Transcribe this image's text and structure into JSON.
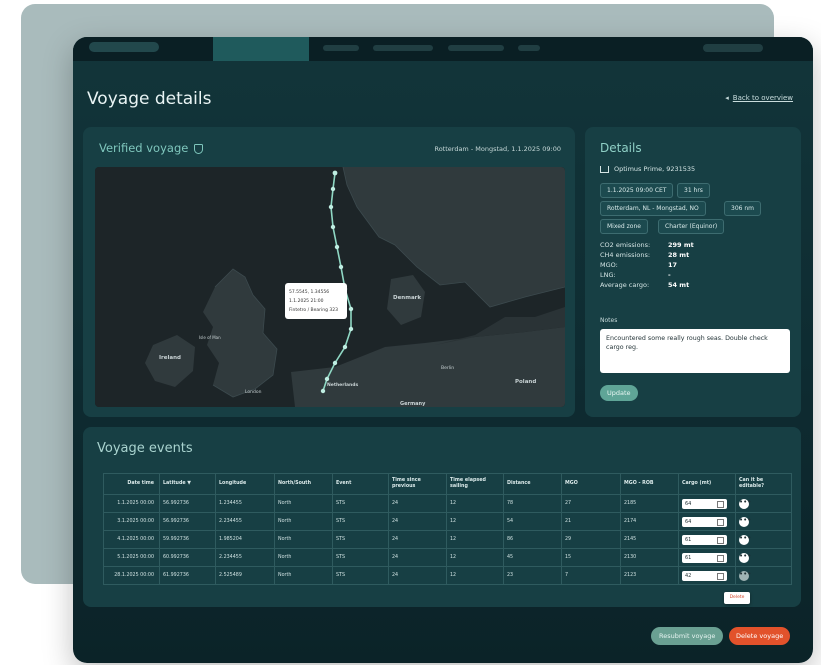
{
  "page": {
    "title": "Voyage details",
    "back_link": "Back to overview"
  },
  "map_panel": {
    "title": "Verified voyage",
    "route_summary": "Rotterdam - Mongstad, 1.1.2025 09:00",
    "popup": [
      "57.5545, 1.34556",
      "1.1.2025 21:00",
      "Fintetro / Bearing 323"
    ],
    "labels": {
      "denmark": "Denmark",
      "isle_of_man": "Isle of Man",
      "ireland": "Ireland",
      "london": "London",
      "netherlands": "Netherlands",
      "berlin": "Berlin",
      "poland": "Poland",
      "germany": "Germany"
    }
  },
  "details": {
    "title": "Details",
    "vessel": "Optimus Prime, 9231535",
    "departure": "1.1.2025 09:00 CET",
    "duration": "31 hrs",
    "route": "Rotterdam, NL - Mongstad, NO",
    "distance": "306 nm",
    "zone": "Mixed zone",
    "charter": "Charter (Equinor)",
    "stats": [
      {
        "label": "CO2 emissions:",
        "value": "299 mt"
      },
      {
        "label": "CH4 emissions:",
        "value": "28 mt"
      },
      {
        "label": "MGO:",
        "value": "17"
      },
      {
        "label": "LNG:",
        "value": "-"
      },
      {
        "label": "Average cargo:",
        "value": "54 mt"
      }
    ],
    "notes_label": "Notes",
    "notes": "Encountered some really rough seas. Double check cargo reg.",
    "update_button": "Update"
  },
  "events": {
    "title": "Voyage events",
    "columns": [
      "Date time",
      "Latitude ▼",
      "Longitude",
      "North/South",
      "Event",
      "Time since previous",
      "Time elapsed sailing",
      "Distance",
      "MGO",
      "MGO - ROB",
      "Cargo (mt)",
      "Can it be editable?"
    ],
    "rows": [
      [
        "1.1.2025 00:00",
        "56.992736",
        "1.234455",
        "North",
        "STS",
        "24",
        "12",
        "78",
        "27",
        "2185",
        "64"
      ],
      [
        "3.1.2025 00:00",
        "56.992736",
        "2.234455",
        "North",
        "STS",
        "24",
        "12",
        "54",
        "21",
        "2174",
        "64"
      ],
      [
        "4.1.2025 00:00",
        "59.992736",
        "1.985204",
        "North",
        "STS",
        "24",
        "12",
        "86",
        "29",
        "2145",
        "61"
      ],
      [
        "5.1.2025 00:00",
        "60.992736",
        "2.234455",
        "North",
        "STS",
        "24",
        "12",
        "45",
        "15",
        "2130",
        "61"
      ],
      [
        "28.1.2025 00:00",
        "61.992736",
        "2.525489",
        "North",
        "STS",
        "24",
        "12",
        "23",
        "7",
        "2123",
        "42"
      ]
    ],
    "tooltip": "Delete"
  },
  "footer": {
    "resubmit": "Resubmit voyage",
    "delete": "Delete voyage"
  }
}
